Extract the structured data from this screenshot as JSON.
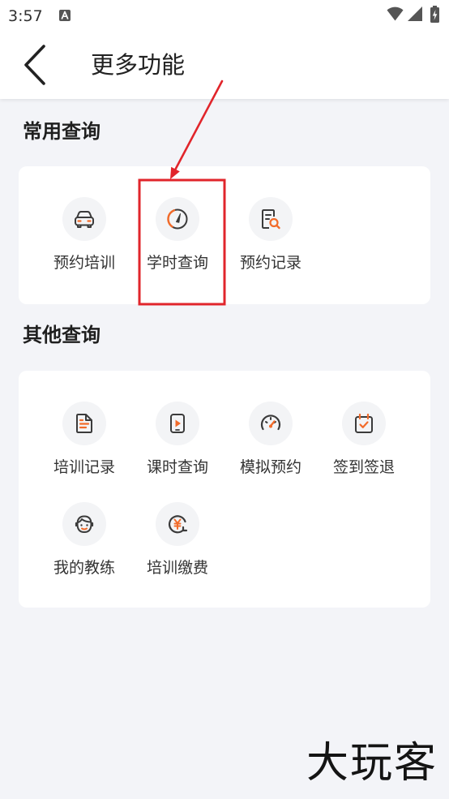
{
  "status_bar": {
    "time": "3:57",
    "notification_icon": "a-badge-icon",
    "icons": [
      "wifi-icon",
      "signal-icon",
      "battery-charging-icon"
    ]
  },
  "header": {
    "back_icon": "chevron-left-icon",
    "title": "更多功能"
  },
  "sections": [
    {
      "title": "常用查询",
      "items": [
        {
          "label": "预约培训",
          "icon": "car-icon"
        },
        {
          "label": "学时查询",
          "icon": "gauge-icon"
        },
        {
          "label": "预约记录",
          "icon": "document-search-icon"
        }
      ]
    },
    {
      "title": "其他查询",
      "items": [
        {
          "label": "培训记录",
          "icon": "document-icon"
        },
        {
          "label": "课时查询",
          "icon": "video-phone-icon"
        },
        {
          "label": "模拟预约",
          "icon": "speedometer-icon"
        },
        {
          "label": "签到签退",
          "icon": "calendar-check-icon"
        },
        {
          "label": "我的教练",
          "icon": "coach-face-icon"
        },
        {
          "label": "培训缴费",
          "icon": "yen-refresh-icon"
        }
      ]
    }
  ],
  "watermark": "大玩客",
  "colors": {
    "accent": "#f26b2a",
    "icon_dark": "#3b3b3b",
    "annotation": "#e1252b",
    "page_background": "#f3f4f8",
    "card_background": "#ffffff",
    "icon_circle": "#f3f4f6"
  }
}
